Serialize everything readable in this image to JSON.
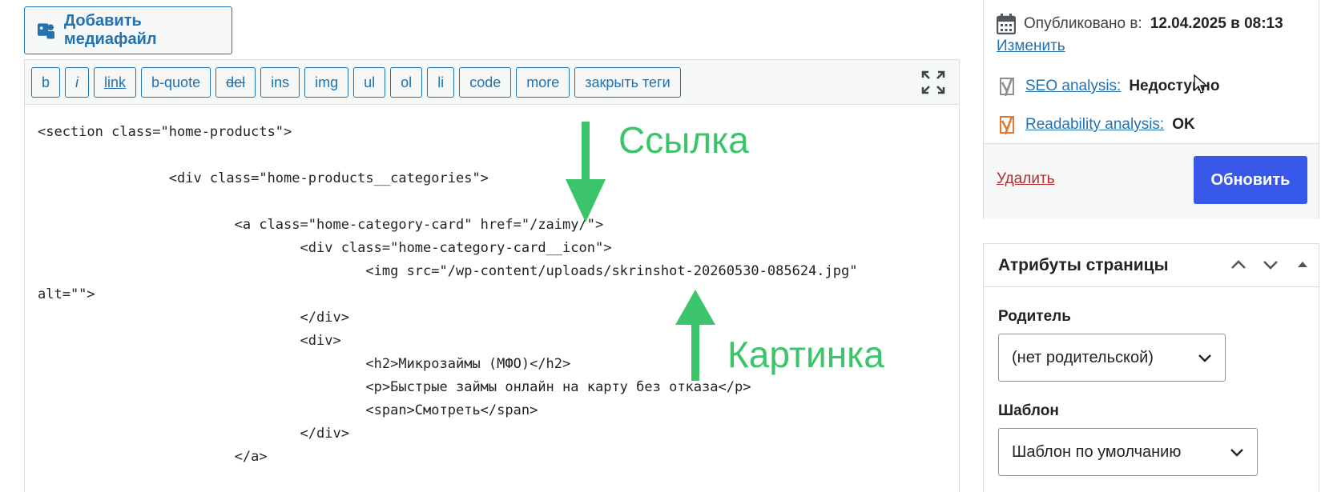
{
  "media": {
    "add_label": "Добавить медиафайл"
  },
  "toolbar": {
    "buttons": [
      "b",
      "i",
      "link",
      "b-quote",
      "del",
      "ins",
      "img",
      "ul",
      "ol",
      "li",
      "code",
      "more",
      "закрыть теги"
    ]
  },
  "code_lines": [
    "<section class=\"home-products\">",
    "                <div class=\"home-products__categories\">",
    "                        <a class=\"home-category-card\" href=\"/zaimy/\">",
    "                                <div class=\"home-category-card__icon\">",
    "                                        <img src=\"/wp-content/uploads/skrinshot-20260530-085624.jpg\"",
    "alt=\"\">",
    "                                </div>",
    "                                <div>",
    "                                        <h2>Микрозаймы (МФО)</h2>",
    "                                        <p>Быстрые займы онлайн на карту без отказа</p>",
    "                                        <span>Смотреть</span>",
    "                                </div>",
    "                        </a>"
  ],
  "annotations": {
    "link_label": "Ссылка",
    "image_label": "Картинка",
    "color": "#3cc46b"
  },
  "publish": {
    "published_prefix": "Опубликовано в:",
    "published_value": "12.04.2025 в 08:13",
    "edit_link": "Изменить",
    "seo_label": "SEO analysis:",
    "seo_value": "Недоступно",
    "readability_label": "Readability analysis:",
    "readability_value": "OK",
    "delete_label": "Удалить",
    "update_label": "Обновить"
  },
  "page_attributes": {
    "title": "Атрибуты страницы",
    "parent_label": "Родитель",
    "parent_value": "(нет родительской)",
    "template_label": "Шаблон",
    "template_value": "Шаблон по умолчанию"
  },
  "colors": {
    "accent": "#2271b1",
    "primary_button": "#3858e9",
    "delete": "#b32d2e",
    "yoast_grey": "#8c8f94",
    "yoast_orange": "#e4792e"
  }
}
